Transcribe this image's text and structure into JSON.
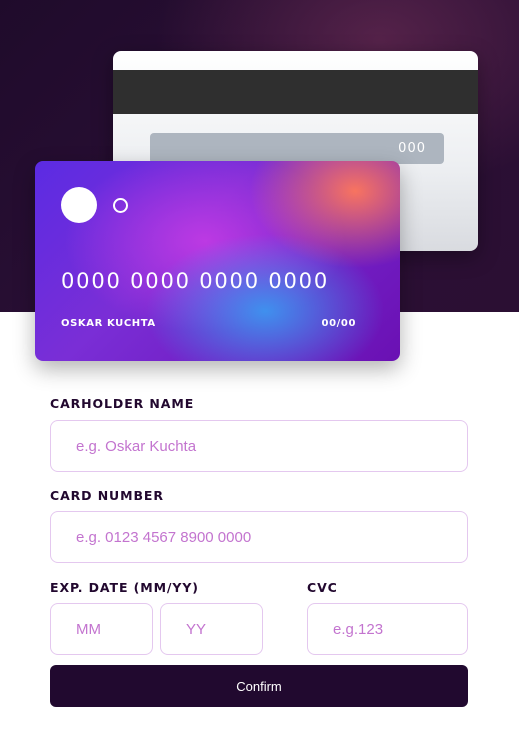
{
  "card_back": {
    "cvc": "000"
  },
  "card_front": {
    "number": "0000 0000 0000 0000",
    "holder": "OSKAR KUCHTA",
    "expiry": "00/00"
  },
  "form": {
    "name_label": "CARHOLDER NAME",
    "name_placeholder": "e.g. Oskar Kuchta",
    "number_label": "CARD NUMBER",
    "number_placeholder": "e.g. 0123 4567 8900 0000",
    "exp_label": "EXP. DATE (MM/YY)",
    "month_placeholder": "MM",
    "year_placeholder": "YY",
    "cvc_label": "CVC",
    "cvc_placeholder": "e.g.123",
    "confirm_label": "Confirm"
  },
  "colors": {
    "dark_purple": "#21092f",
    "input_border": "#e4c8ef",
    "placeholder": "#c374cf"
  }
}
